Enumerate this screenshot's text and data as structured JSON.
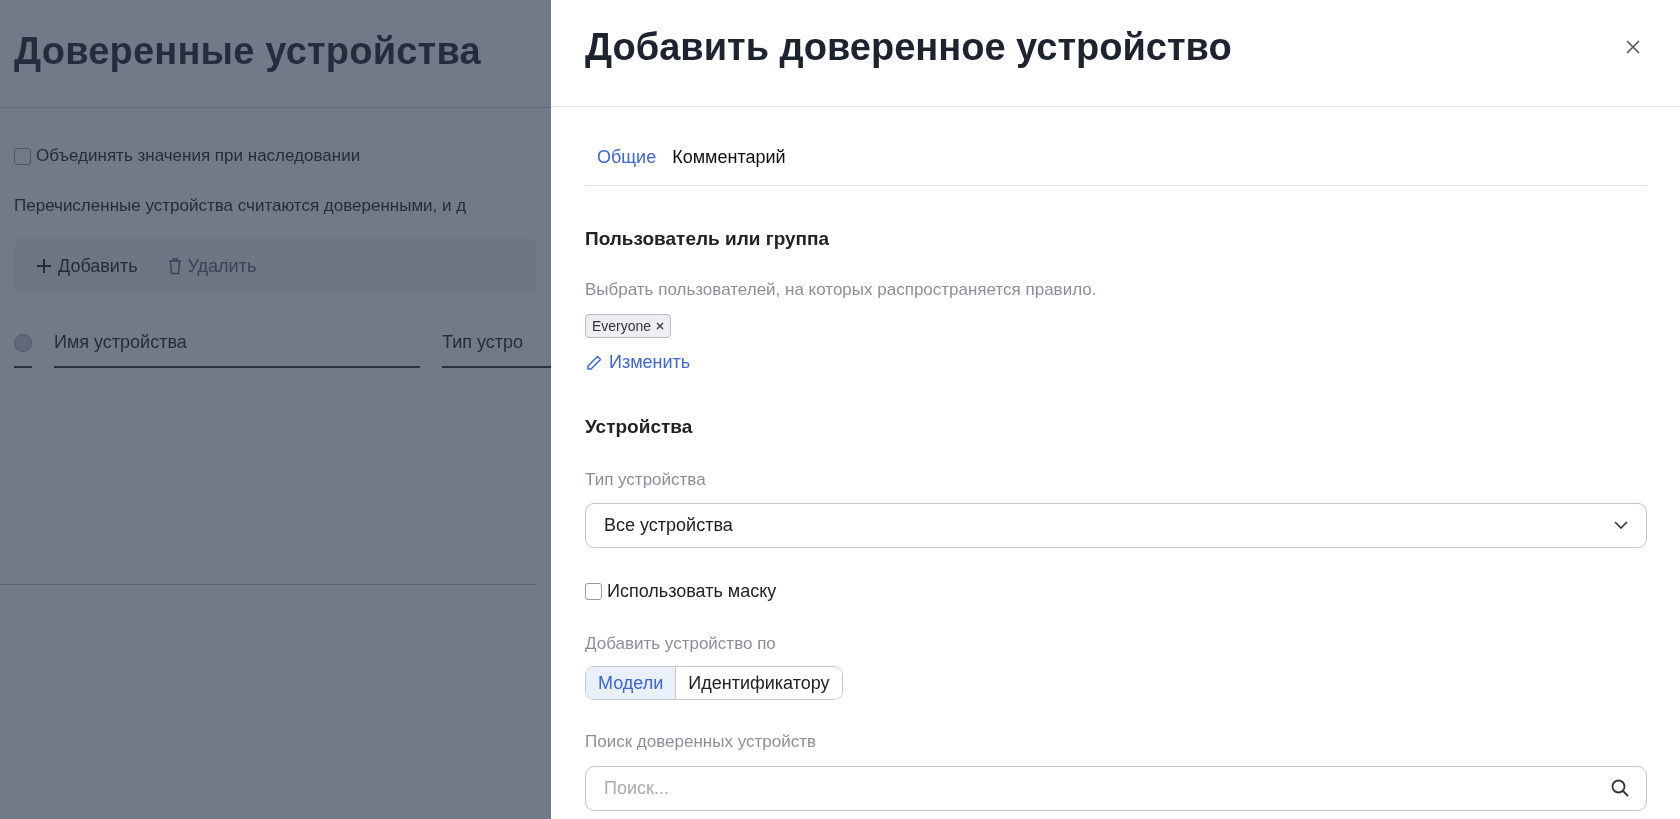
{
  "page": {
    "title": "Доверенные устройства",
    "merge_checkbox": {
      "label": "Объединять значения при наследовании",
      "checked": false
    },
    "description": "Перечисленные устройства считаются доверенными, и д",
    "toolbar": [
      {
        "kind": "add",
        "label": "Добавить",
        "disabled": false
      },
      {
        "kind": "delete",
        "label": "Удалить",
        "disabled": true
      }
    ],
    "table": {
      "select_all": {
        "checked": false
      },
      "columns": [
        "Имя устройства",
        "Тип устро"
      ]
    }
  },
  "drawer": {
    "title": "Добавить доверенное устройство",
    "tabs": [
      {
        "label": "Общие",
        "selected": true
      },
      {
        "label": "Комментарий",
        "selected": false
      }
    ],
    "user_section": {
      "title": "Пользователь или группа",
      "hint": "Выбрать пользователей, на которых распространяется правило.",
      "chips": [
        {
          "label": "Everyone"
        }
      ],
      "edit_link": "Изменить"
    },
    "devices_section": {
      "title": "Устройства",
      "device_type": {
        "label": "Тип устройства",
        "value": "Все устройства"
      },
      "mask_checkbox": {
        "label": "Использовать маску",
        "checked": false
      },
      "add_by": {
        "label": "Добавить устройство по",
        "options": [
          {
            "label": "Модели",
            "selected": true
          },
          {
            "label": "Идентификатору",
            "selected": false
          }
        ]
      },
      "search": {
        "label": "Поиск доверенных устройств",
        "placeholder": "Поиск..."
      }
    }
  }
}
